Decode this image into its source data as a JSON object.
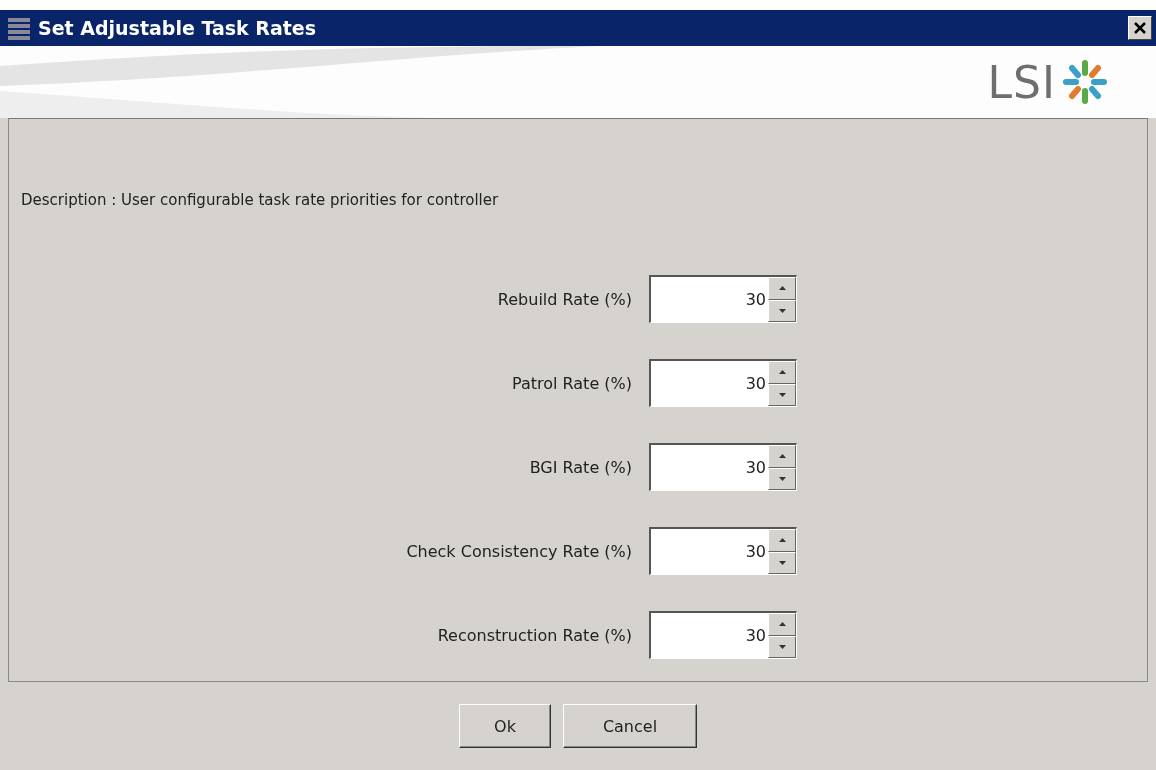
{
  "window": {
    "title": "Set Adjustable Task Rates"
  },
  "header": {
    "logo_text": "LSI"
  },
  "description": "Description : User configurable task rate priorities for controller",
  "rates": [
    {
      "label": "Rebuild Rate (%)",
      "value": "30"
    },
    {
      "label": "Patrol Rate (%)",
      "value": "30"
    },
    {
      "label": "BGI Rate (%)",
      "value": "30"
    },
    {
      "label": "Check Consistency Rate (%)",
      "value": "30"
    },
    {
      "label": "Reconstruction Rate (%)",
      "value": "30"
    }
  ],
  "buttons": [
    "Ok",
    "Cancel"
  ]
}
